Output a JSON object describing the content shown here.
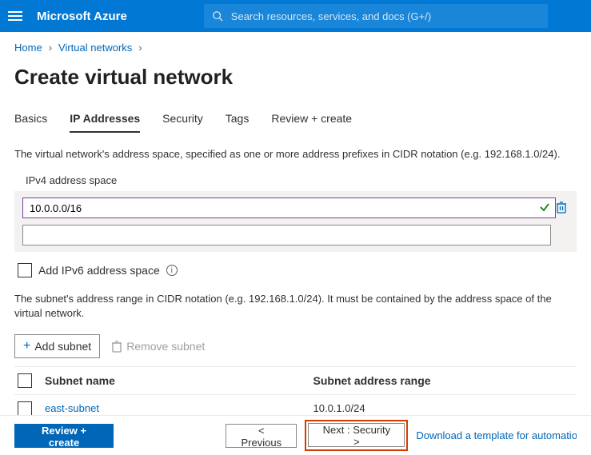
{
  "header": {
    "brand": "Microsoft Azure",
    "search_placeholder": "Search resources, services, and docs (G+/)"
  },
  "breadcrumb": {
    "home": "Home",
    "vnets": "Virtual networks"
  },
  "page": {
    "title": "Create virtual network"
  },
  "tabs": {
    "basics": "Basics",
    "ip": "IP Addresses",
    "security": "Security",
    "tags": "Tags",
    "review": "Review + create"
  },
  "addr": {
    "description": "The virtual network's address space, specified as one or more address prefixes in CIDR notation (e.g. 192.168.1.0/24).",
    "label": "IPv4 address space",
    "row0": "10.0.0.0/16",
    "row1": ""
  },
  "ipv6": {
    "label": "Add IPv6 address space"
  },
  "subnet": {
    "description": "The subnet's address range in CIDR notation (e.g. 192.168.1.0/24). It must be contained by the address space of the virtual network.",
    "add_label": "Add subnet",
    "remove_label": "Remove subnet",
    "col_name": "Subnet name",
    "col_range": "Subnet address range",
    "rows": [
      {
        "name": "east-subnet",
        "range": "10.0.1.0/24"
      }
    ]
  },
  "footer": {
    "review": "Review + create",
    "previous": "< Previous",
    "next": "Next : Security >",
    "download": "Download a template for automation"
  }
}
